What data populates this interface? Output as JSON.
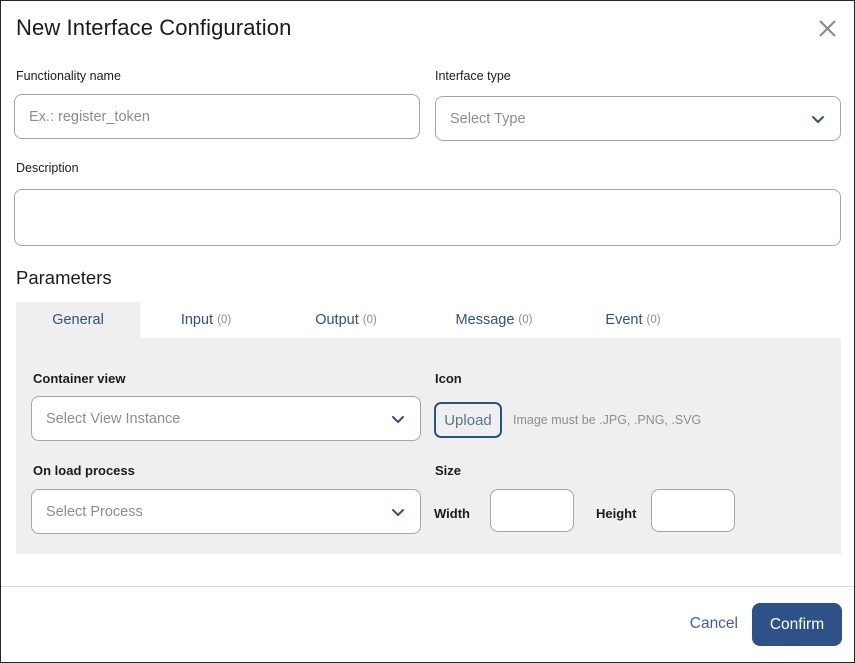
{
  "dialog": {
    "title": "New Interface Configuration",
    "close_icon": "close-x-icon"
  },
  "form": {
    "functionality_name": {
      "label": "Functionality name",
      "value": "",
      "placeholder": "Ex.: register_token"
    },
    "interface_type": {
      "label": "Interface type",
      "selected": "Select Type",
      "chevron_icon": "chevron-down-icon"
    },
    "description": {
      "label": "Description",
      "value": "",
      "placeholder": ""
    }
  },
  "parameters": {
    "title": "Parameters",
    "tabs": [
      {
        "label": "General",
        "count": "",
        "active": true
      },
      {
        "label": "Input",
        "count": "(0)",
        "active": false
      },
      {
        "label": "Output",
        "count": "(0)",
        "active": false
      },
      {
        "label": "Message",
        "count": "(0)",
        "active": false
      },
      {
        "label": "Event",
        "count": "(0)",
        "active": false
      }
    ],
    "general": {
      "container_view": {
        "label": "Container view",
        "selected": "Select View Instance",
        "chevron_icon": "chevron-down-icon"
      },
      "on_load_process": {
        "label": "On load process",
        "selected": "Select Process",
        "chevron_icon": "chevron-down-icon"
      },
      "icon": {
        "label": "Icon",
        "upload_label": "Upload",
        "hint": "Image must be .JPG, .PNG, .SVG"
      },
      "size": {
        "label": "Size",
        "width_label": "Width",
        "width_value": "",
        "height_label": "Height",
        "height_value": ""
      }
    }
  },
  "footer": {
    "cancel_label": "Cancel",
    "confirm_label": "Confirm"
  },
  "colors": {
    "accent_blue": "#2d5182",
    "confirm_bg": "#2e5288",
    "panel_bg": "#efefef",
    "border_gray": "#a6a6a6",
    "placeholder_gray": "#8d8d8d"
  }
}
